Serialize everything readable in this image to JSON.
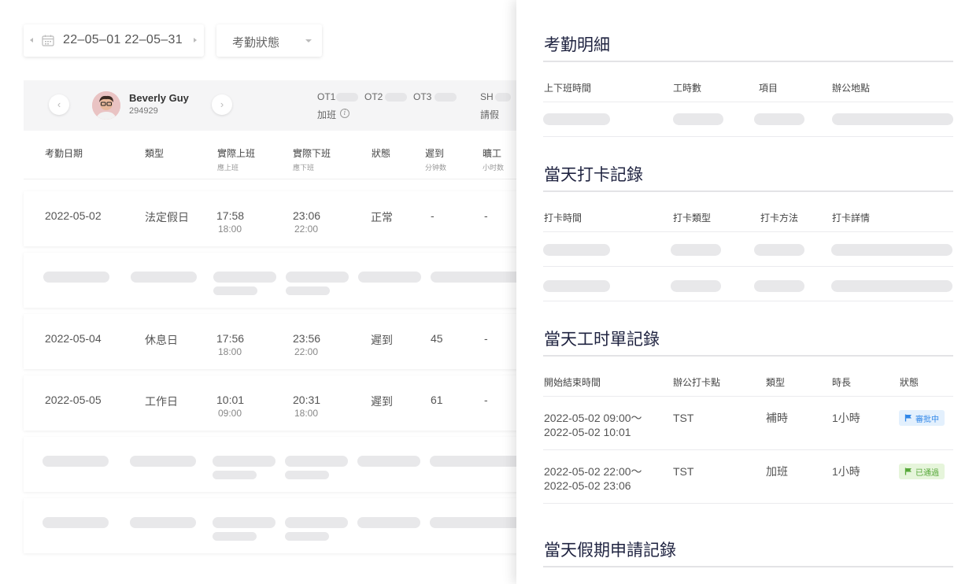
{
  "filters": {
    "date_range": "22–05–01 22–05–31",
    "status_placeholder": "考勤狀態"
  },
  "employee": {
    "name": "Beverly Guy",
    "id": "294929",
    "ot1_label": "OT1",
    "ot2_label": "OT2",
    "ot3_label": "OT3",
    "sh_label": "SH",
    "overtime_label": "加班",
    "leave_label": "請假",
    "prev_icon": "chevron-left-icon",
    "next_icon": "chevron-right-icon"
  },
  "table": {
    "headers": {
      "date": "考勤日期",
      "type": "類型",
      "actual_in": "實際上班",
      "actual_in_sub": "應上班",
      "actual_out": "實際下班",
      "actual_out_sub": "應下班",
      "status": "狀態",
      "late": "遲到",
      "late_sub": "分钟数",
      "absent": "曠工",
      "absent_sub": "小时数"
    },
    "rows": [
      {
        "date": "2022-05-02",
        "type": "法定假日",
        "in": "17:58",
        "in_expected": "18:00",
        "out": "23:06",
        "out_expected": "22:00",
        "status": "正常",
        "late": "-",
        "absent": "-"
      },
      {
        "date": "2022-05-04",
        "type": "休息日",
        "in": "17:56",
        "in_expected": "18:00",
        "out": "23:56",
        "out_expected": "22:00",
        "status": "遲到",
        "late": "45",
        "absent": "-"
      },
      {
        "date": "2022-05-05",
        "type": "工作日",
        "in": "10:01",
        "in_expected": "09:00",
        "out": "20:31",
        "out_expected": "18:00",
        "status": "遲到",
        "late": "61",
        "absent": "-"
      }
    ]
  },
  "drawer": {
    "detail": {
      "title": "考勤明細",
      "headers": [
        "上下班時間",
        "工時數",
        "項目",
        "辦公地點"
      ]
    },
    "clock": {
      "title": "當天打卡記錄",
      "headers": [
        "打卡時間",
        "打卡類型",
        "打卡方法",
        "打卡詳情"
      ]
    },
    "timesheet": {
      "title": "當天工时單記錄",
      "headers": [
        "開始結束時間",
        "辦公打卡點",
        "類型",
        "時長",
        "狀態"
      ],
      "rows": [
        {
          "time_line1": "2022-05-02 09:00～",
          "time_line2": "2022-05-02 10:01",
          "location": "TST",
          "type": "補時",
          "duration": "1小時",
          "status": "審批中",
          "status_color": "#2f86e8"
        },
        {
          "time_line1": "2022-05-02 22:00～",
          "time_line2": "2022-05-02 23:06",
          "location": "TST",
          "type": "加班",
          "duration": "1小時",
          "status": "已通過",
          "status_color": "#57a83a"
        }
      ]
    },
    "leave": {
      "title": "當天假期申請記錄"
    }
  }
}
